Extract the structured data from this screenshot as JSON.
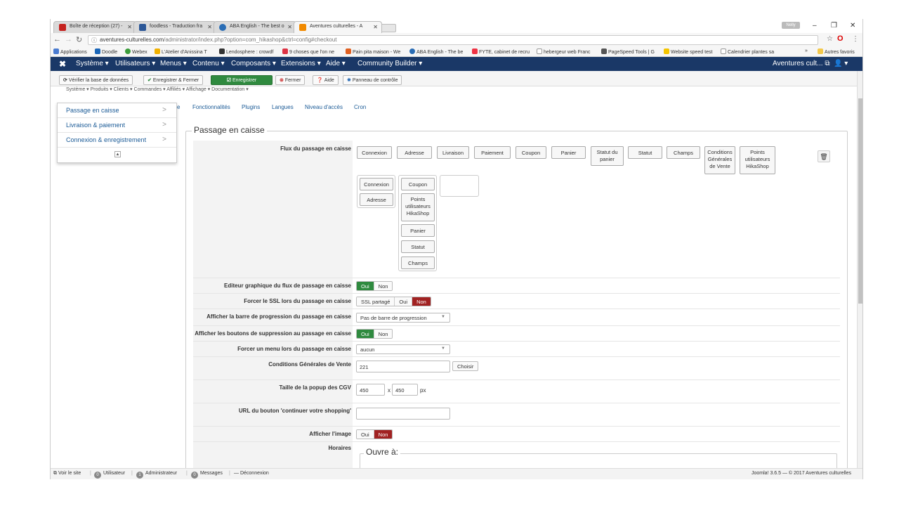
{
  "browser": {
    "tabs": [
      {
        "title": "Boîte de réception (27) -",
        "icon_color": "#c5221f"
      },
      {
        "title": "foodless - Traduction fra",
        "icon_color": "#2b5797"
      },
      {
        "title": "ABA English - The best o",
        "icon_color": "#2a6db5"
      },
      {
        "title": "Aventures culturelles - A",
        "icon_color": "#f18a00"
      }
    ],
    "user_chip": "Nelly",
    "url_host": "aventures-culturelles.com",
    "url_path": "/administrator/index.php?option=com_hikashop&ctrl=config#checkout",
    "bookmarks": [
      "Applications",
      "Doodle",
      "Webex",
      "L'Atelier d'Anissina T",
      "Lendosphere : crowdf",
      "9 choses que l'on ne",
      "Pain pita maison - We",
      "ABA English - The be",
      "FYTE, cabinet de recru",
      "hebergeur web Franc",
      "PageSpeed Tools | G",
      "Website speed test",
      "Calendrier plantes sa",
      "»",
      "Autres favoris"
    ]
  },
  "menubar": {
    "items": [
      "Système ▾",
      "Utilisateurs ▾",
      "Menus ▾",
      "Contenu ▾",
      "Composants ▾",
      "Extensions ▾",
      "Aide ▾",
      "Community Builder ▾"
    ],
    "site_name": "Aventures cult...",
    "user_icon": "👤 ▾"
  },
  "toolbar": {
    "check_db": "Vérifier la base de données",
    "save_close": "Enregistrer & Fermer",
    "save": "Enregistrer",
    "close": "Fermer",
    "help": "Aide",
    "control_panel": "Panneau de contrôle"
  },
  "hikashop_menu": "Système ▾   Produits ▾   Clients ▾   Commandes ▾   Affiliés ▾   Affichage ▾   Documentation ▾",
  "dropdown": {
    "items": [
      "Passage en caisse",
      "Livraison & paiement",
      "Connexion & enregistrement"
    ]
  },
  "subtabs": [
    "e",
    "Fonctionnalités",
    "Plugins",
    "Langues",
    "Niveau d'accès",
    "Cron"
  ],
  "fieldset_title": "Passage en caisse",
  "flow": {
    "label": "Flux du passage en caisse",
    "available": [
      "Connexion",
      "Adresse",
      "Livraison",
      "Paiement",
      "Coupon",
      "Panier",
      "Statut du panier",
      "Statut",
      "Champs",
      "Conditions Générales de Vente",
      "Points utilisateurs HikaShop"
    ],
    "col1": [
      "Connexion",
      "Adresse"
    ],
    "col2": [
      "Coupon",
      "Points utilisateurs HikaShop",
      "Panier",
      "Statut",
      "Champs"
    ]
  },
  "settings": {
    "graphic_editor": {
      "label": "Editeur graphique du flux de passage en caisse",
      "yes": "Oui",
      "no": "Non"
    },
    "force_ssl": {
      "label": "Forcer le SSL lors du passage en caisse",
      "shared": "SSL partagé",
      "yes": "Oui",
      "no": "Non"
    },
    "progress_bar": {
      "label": "Afficher la barre de progression du passage en caisse",
      "value": "Pas de barre de progression"
    },
    "delete_buttons": {
      "label": "Afficher les boutons de suppression au passage en caisse",
      "yes": "Oui",
      "no": "Non"
    },
    "force_menu": {
      "label": "Forcer un menu lors du passage en caisse",
      "value": "aucun"
    },
    "terms": {
      "label": "Conditions Générales de Vente",
      "value": "221",
      "choose": "Choisir"
    },
    "popup_size": {
      "label": "Taille de la popup des CGV",
      "width": "450",
      "x": "x",
      "height": "450",
      "unit": "px"
    },
    "continue_url": {
      "label": "URL du bouton 'continuer votre shopping'",
      "value": ""
    },
    "show_image": {
      "label": "Afficher l'image",
      "yes": "Oui",
      "no": "Non"
    },
    "hours": {
      "label": "Horaires",
      "legend": "Ouvre à:"
    }
  },
  "statusbar": {
    "view_site": "Voir le site",
    "visitors_count": "0",
    "visitors": "Utilisateur",
    "admins_count": "1",
    "admins": "Administrateur",
    "messages_count": "0",
    "messages": "Messages",
    "logout": "Déconnexion",
    "version": "Joomla! 3.6.5 — © 2017 Aventures culturelles"
  }
}
